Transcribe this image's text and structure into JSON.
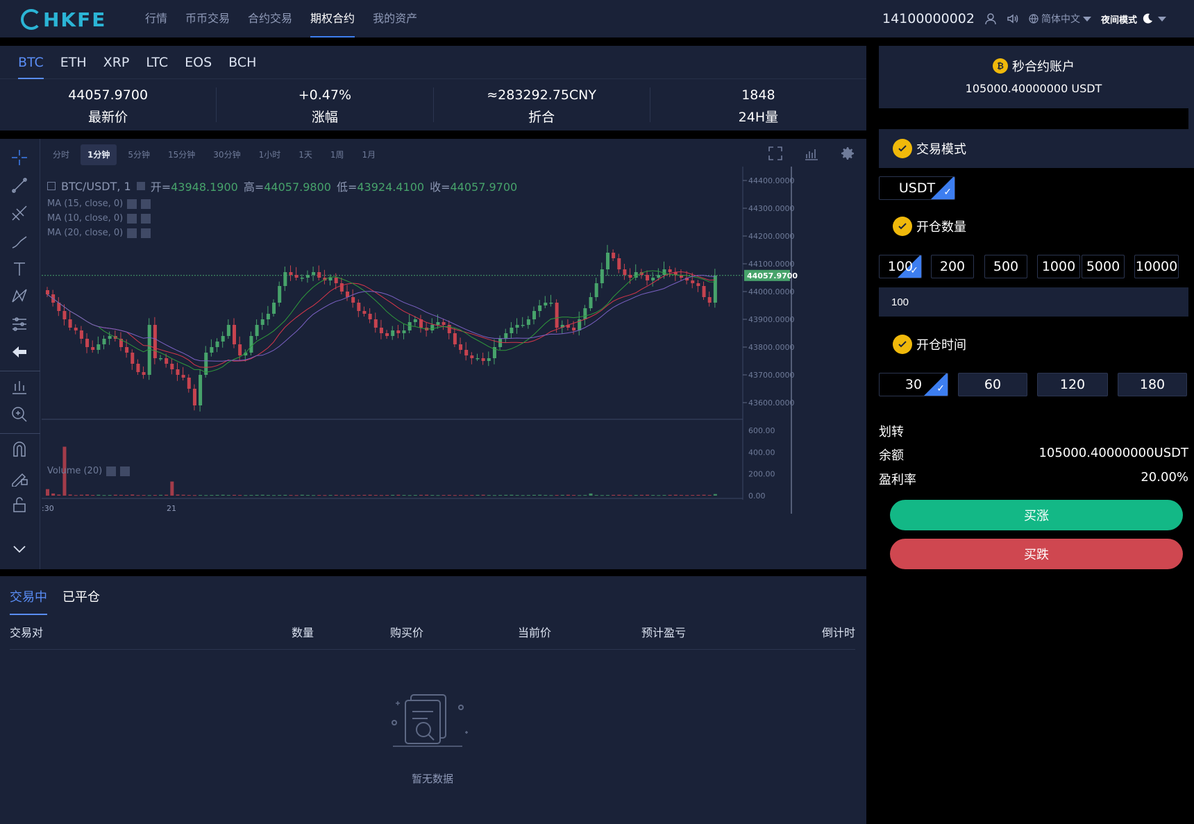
{
  "brand": {
    "logo_text": "HKFE"
  },
  "nav": {
    "links": [
      "行情",
      "币币交易",
      "合约交易",
      "期权合约",
      "我的资产"
    ],
    "active_index": 3,
    "phone": "14100000002",
    "language": "简体中文",
    "night_mode": "夜间模式"
  },
  "coins": {
    "tabs": [
      "BTC",
      "ETH",
      "XRP",
      "LTC",
      "EOS",
      "BCH"
    ],
    "active": "BTC"
  },
  "stats": [
    {
      "value": "44057.9700",
      "label": "最新价"
    },
    {
      "value": "+0.47%",
      "label": "涨幅"
    },
    {
      "value": "≈283292.75CNY",
      "label": "折合"
    },
    {
      "value": "1848",
      "label": "24H量"
    }
  ],
  "chart": {
    "timeframes": [
      "分时",
      "1分钟",
      "5分钟",
      "15分钟",
      "30分钟",
      "1小时",
      "1天",
      "1周",
      "1月"
    ],
    "active_timeframe": "1分钟",
    "symbol": "BTC/USDT, 1",
    "ohlc": {
      "open_label": "开=",
      "open": "43948.1900",
      "high_label": "高=",
      "high": "44057.9800",
      "low_label": "低=",
      "low": "43924.4100",
      "close_label": "收=",
      "close": "44057.9700"
    },
    "ma_labels": [
      "MA (15, close, 0)",
      "MA (10, close, 0)",
      "MA (20, close, 0)"
    ],
    "volume_label": "Volume (20)",
    "price_axis": [
      "44400.0000",
      "44300.0000",
      "44200.0000",
      "44100.0000",
      "44000.0000",
      "43900.0000",
      "43800.0000",
      "43700.0000",
      "43600.0000"
    ],
    "current_price_tag": "44057.9700",
    "volume_axis": [
      "600.00",
      "400.00",
      "200.00",
      "0.00"
    ],
    "time_axis": [
      ":30",
      "21"
    ],
    "colors": {
      "up": "#47a36b",
      "down": "#c6434f",
      "ma15": "#d8364a",
      "ma10": "#2f9a3b",
      "ma20": "#7b61c4"
    }
  },
  "chart_data": {
    "type": "candlestick",
    "symbol": "BTC/USDT",
    "interval": "1",
    "ylim": [
      43550,
      44450
    ],
    "current_price": 44057.97,
    "close_series": [
      43990,
      43960,
      43930,
      43900,
      43870,
      43860,
      43830,
      43800,
      43790,
      43810,
      43830,
      43840,
      43830,
      43800,
      43780,
      43740,
      43710,
      43700,
      43880,
      43760,
      43760,
      43740,
      43720,
      43700,
      43690,
      43650,
      43590,
      43700,
      43780,
      43800,
      43820,
      43840,
      43880,
      43810,
      43770,
      43780,
      43840,
      43880,
      43900,
      43920,
      43960,
      44020,
      44070,
      44060,
      44050,
      44050,
      44060,
      44070,
      44050,
      44040,
      44050,
      44030,
      44000,
      43980,
      43960,
      43930,
      43920,
      43900,
      43870,
      43850,
      43840,
      43860,
      43850,
      43860,
      43890,
      43900,
      43870,
      43860,
      43880,
      43890,
      43880,
      43850,
      43810,
      43790,
      43770,
      43760,
      43760,
      43750,
      43760,
      43800,
      43830,
      43850,
      43870,
      43880,
      43880,
      43900,
      43930,
      43950,
      43960,
      43960,
      43870,
      43880,
      43870,
      43860,
      43900,
      43940,
      43980,
      44030,
      44080,
      44140,
      44120,
      44080,
      44060,
      44050,
      44070,
      44060,
      44040,
      44050,
      44060,
      44080,
      44070,
      44060,
      44050,
      44040,
      44030,
      44020,
      43980,
      43960,
      44058
    ],
    "volume_series": [
      60,
      20,
      10,
      450,
      10,
      5,
      8,
      10,
      6,
      8,
      5,
      6,
      8,
      7,
      6,
      10,
      5,
      6,
      5,
      6,
      7,
      8,
      130,
      10,
      8,
      6,
      5,
      6,
      5,
      6,
      7,
      8,
      6,
      7,
      6,
      5,
      6,
      7,
      8,
      6,
      5,
      6,
      7,
      6,
      5,
      8,
      6,
      5,
      6,
      5,
      6,
      7,
      5,
      6,
      5,
      6,
      7,
      8,
      6,
      5,
      6,
      7,
      8,
      6,
      5,
      6,
      7,
      8,
      6,
      5,
      6,
      7,
      5,
      6,
      5,
      6,
      7,
      8,
      6,
      5,
      6,
      7,
      8,
      6,
      5,
      6,
      7,
      8,
      6,
      5,
      6,
      7,
      8,
      6,
      5,
      6,
      20,
      6,
      5,
      6,
      7,
      8,
      6,
      5,
      6,
      7,
      8,
      6,
      5,
      6,
      7,
      8,
      6,
      5,
      6,
      7,
      8,
      6,
      15
    ]
  },
  "positions": {
    "tabs": [
      "交易中",
      "已平仓"
    ],
    "active_tab": "交易中",
    "columns": [
      "交易对",
      "数量",
      "购买价",
      "当前价",
      "预计盈亏",
      "倒计时"
    ],
    "empty_text": "暂无数据"
  },
  "right_panel": {
    "account_title": "秒合约账户",
    "account_balance": "105000.40000000 USDT",
    "mode_title": "交易模式",
    "mode_option": "USDT",
    "qty_title": "开仓数量",
    "qty_options": [
      "100",
      "200",
      "500",
      "1000",
      "5000",
      "10000"
    ],
    "qty_selected": "100",
    "qty_input_value": "100",
    "time_title": "开仓时间",
    "time_options": [
      "30",
      "60",
      "120",
      "180"
    ],
    "time_selected": "30",
    "transfer_label": "划转",
    "balance_label": "余额",
    "balance_value": "105000.40000000USDT",
    "profit_label": "盈利率",
    "profit_value": "20.00%",
    "buy_up": "买涨",
    "buy_down": "买跌"
  }
}
